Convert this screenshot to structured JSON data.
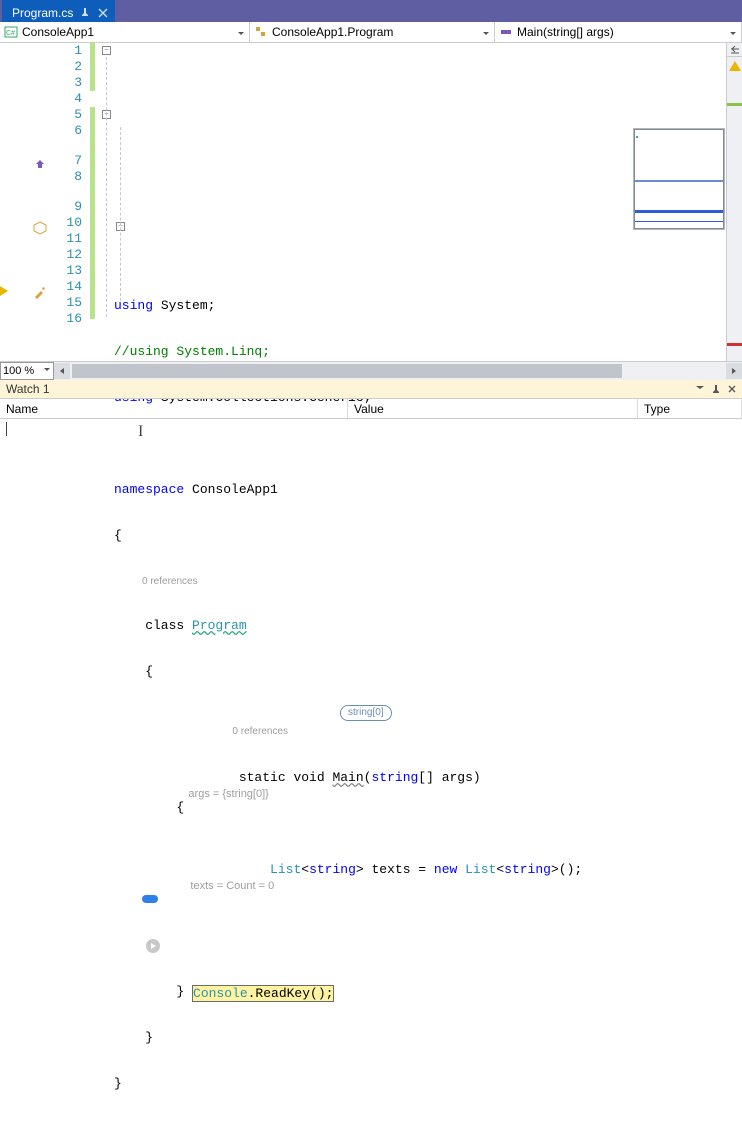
{
  "tab": {
    "filename": "Program.cs"
  },
  "dropdowns": {
    "project": "ConsoleApp1",
    "class": "ConsoleApp1.Program",
    "member": "Main(string[] args)"
  },
  "zoom": "100 %",
  "code": {
    "l1a": "using",
    "l1b": " System;",
    "l2a": "//using System.Linq;",
    "l3a": "using",
    "l3b": " System.Collections.Generic;",
    "l5a": "namespace",
    "l5b": " ConsoleApp1",
    "l6": "{",
    "ref1": "0 references",
    "l7a": "    class ",
    "l7b": "Program",
    "l8": "    {",
    "ref2": "0 references",
    "hintArgs": "string[0]",
    "l9a": "        static void ",
    "l9b": "Main",
    "l9c": "(",
    "l9d": "string",
    "l9e": "[] args)",
    "l9hint": "args = {string[0]}",
    "l10": "        {",
    "l11a": "            ",
    "l11b": "List",
    "l11c": "<",
    "l11d": "string",
    "l11e": "> texts = ",
    "l11f": "new",
    "l11g": " ",
    "l11h": "List",
    "l11i": "<",
    "l11j": "string",
    "l11k": ">();",
    "l11hint": "texts = Count = 0",
    "l13a": "Console",
    "l13b": ".ReadKey();",
    "l14": "        }",
    "l15": "    }",
    "l16": "}"
  },
  "lineNumbers": [
    "1",
    "2",
    "3",
    "4",
    "5",
    "6",
    "7",
    "8",
    "9",
    "10",
    "11",
    "12",
    "13",
    "14",
    "15",
    "16"
  ],
  "watch": {
    "title": "Watch 1",
    "cols": {
      "name": "Name",
      "value": "Value",
      "type": "Type"
    }
  }
}
